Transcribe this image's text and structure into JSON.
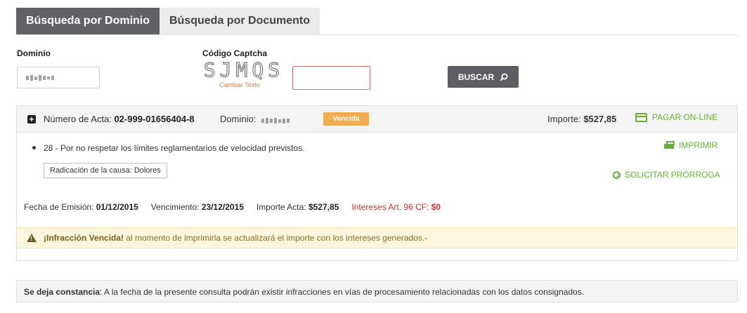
{
  "tabs": [
    {
      "label": "Búsqueda por Dominio",
      "active": true
    },
    {
      "label": "Búsqueda por Documento",
      "active": false
    }
  ],
  "form": {
    "dominio_label": "Dominio",
    "captcha_label": "Código Captcha",
    "captcha_text": "SJMQS",
    "cambiar_texto": "Cambiar Texto",
    "captcha_value": "",
    "buscar_label": "BUSCAR"
  },
  "acta": {
    "numero_label": "Número de Acta:",
    "numero": "02-999-01656404-8",
    "dominio_label": "Dominio:",
    "estado": "Vencida",
    "importe_label": "Importe:",
    "importe": "$527,85",
    "pagar_label": "PAGAR ON-LINE",
    "infraccion": "28 - Por no respetar los límites reglamentarios de velocidad previstos.",
    "radicacion": "Radicación de la causa: Dolores",
    "imprimir_label": "IMPRIMIR",
    "solicitar_label": "SOLICITAR PRÓRROGA",
    "fecha_emision_label": "Fecha de Emisión:",
    "fecha_emision": "01/12/2015",
    "vencimiento_label": "Vencimiento:",
    "vencimiento": "23/12/2015",
    "importe_acta_label": "Importe Acta:",
    "importe_acta": "$527,85",
    "intereses_label": "Intereses Art. 96 CF:",
    "intereses": "$0",
    "alert_bold": "¡Infracción Vencida!",
    "alert_rest": " al momento de imprimirla se actualizará el importe con los intereses generados.-"
  },
  "notice": {
    "bold": "Se deja constancia",
    "rest": ": A la fecha de la presente consulta podrán existir infracciones en vías de procesamiento relacionadas con los datos consignados."
  },
  "colors": {
    "accent_green": "#66b032",
    "badge_orange": "#f0ac50",
    "interest_red": "#e02a2a",
    "tab_dark": "#5f6166"
  },
  "icons": [
    "plus-square-icon",
    "search-icon",
    "credit-card-icon",
    "printer-icon",
    "clock-icon",
    "warning-icon"
  ]
}
